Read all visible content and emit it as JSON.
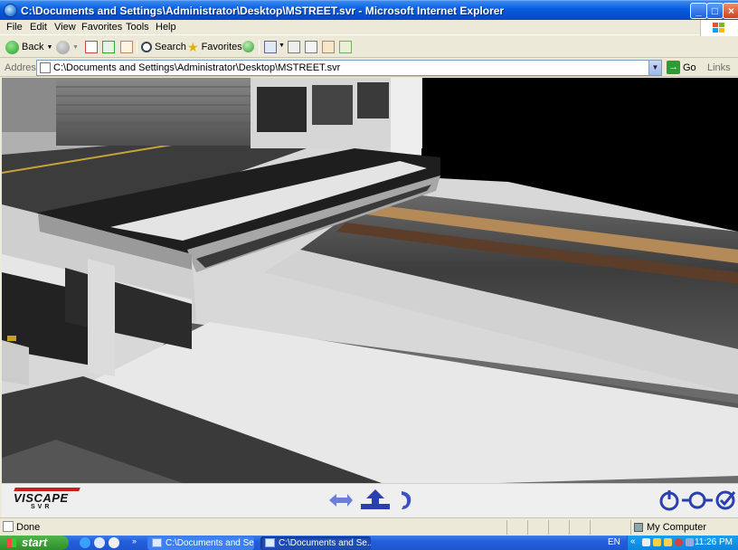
{
  "window": {
    "title": "C:\\Documents and Settings\\Administrator\\Desktop\\MSTREET.svr - Microsoft Internet Explorer",
    "buttons": {
      "minimize": "_",
      "maximize": "□",
      "close": "×"
    }
  },
  "menu": {
    "items": [
      "File",
      "Edit",
      "View",
      "Favorites",
      "Tools",
      "Help"
    ]
  },
  "toolbar": {
    "back": "Back",
    "search": "Search",
    "favorites": "Favorites"
  },
  "address": {
    "label": "Address",
    "value": "C:\\Documents and Settings\\Administrator\\Desktop\\MSTREET.svr",
    "go": "Go",
    "links": "Links"
  },
  "viewer": {
    "logo_text": "VISCAPE",
    "logo_sub": "SVR",
    "controls_left": [
      "arrow-left-right-icon",
      "arrow-up-move-icon",
      "rotate-icon"
    ],
    "controls_right": [
      "power-icon",
      "zoom-slider-icon",
      "check-icon"
    ]
  },
  "status": {
    "text": "Done",
    "zone": "My Computer"
  },
  "taskbar": {
    "start": "start",
    "tasks": [
      "C:\\Documents and Se...",
      "C:\\Documents and Se..."
    ],
    "lang": "EN",
    "clock": "11:26 PM"
  },
  "colors": {
    "title_blue": "#0a5fe0",
    "start_green": "#3a9a34",
    "taskbar_blue": "#245edb",
    "control_blue": "#2a3fb0"
  }
}
